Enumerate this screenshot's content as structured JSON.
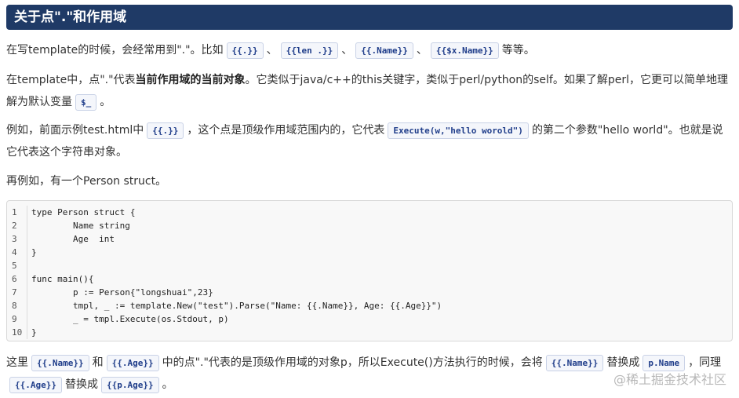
{
  "heading": "关于点\".\"和作用域",
  "para1": {
    "t1": "在写template的时候，会经常用到\".\"。比如",
    "c1": "{{.}}",
    "s1": "、",
    "c2": "{{len .}}",
    "s2": "、",
    "c3": "{{.Name}}",
    "s3": "、",
    "c4": "{{$x.Name}}",
    "t2": "等等。"
  },
  "para2": {
    "t1": "在template中，点\".\"代表",
    "bold": "当前作用域的当前对象",
    "t2": "。它类似于java/c++的this关键字，类似于perl/python的self。如果了解perl，它更可以简单地理解为默认变量",
    "c1": "$_",
    "t3": "。"
  },
  "para3": {
    "t1": "例如，前面示例test.html中",
    "c1": "{{.}}",
    "t2": "，这个点是顶级作用域范围内的，它代表",
    "c2": "Execute(w,\"hello worold\")",
    "t3": "的第二个参数\"hello world\"。也就是说它代表这个字符串对象。"
  },
  "para4": "再例如，有一个Person struct。",
  "code_lines": [
    {
      "n": "1",
      "text": "type Person struct {"
    },
    {
      "n": "2",
      "text": "        Name string"
    },
    {
      "n": "3",
      "text": "        Age  int"
    },
    {
      "n": "4",
      "text": "}"
    },
    {
      "n": "5",
      "text": ""
    },
    {
      "n": "6",
      "text": "func main(){"
    },
    {
      "n": "7",
      "text": "        p := Person{\"longshuai\",23}"
    },
    {
      "n": "8",
      "text": "        tmpl, _ := template.New(\"test\").Parse(\"Name: {{.Name}}, Age: {{.Age}}\")"
    },
    {
      "n": "9",
      "text": "        _ = tmpl.Execute(os.Stdout, p)"
    },
    {
      "n": "10",
      "text": "}"
    }
  ],
  "para5": {
    "t1": "这里",
    "c1": "{{.Name}}",
    "t2": "和",
    "c2": "{{.Age}}",
    "t3": "中的点\".\"代表的是顶级作用域的对象p，所以Execute()方法执行的时候，会将",
    "c3": "{{.Name}}",
    "t4": "替换成",
    "c4": "p.Name",
    "t5": "，同理",
    "c5": "{{.Age}}",
    "t6": "替换成",
    "c6": "{{p.Age}}",
    "t7": "。"
  },
  "watermark": "@稀土掘金技术社区"
}
